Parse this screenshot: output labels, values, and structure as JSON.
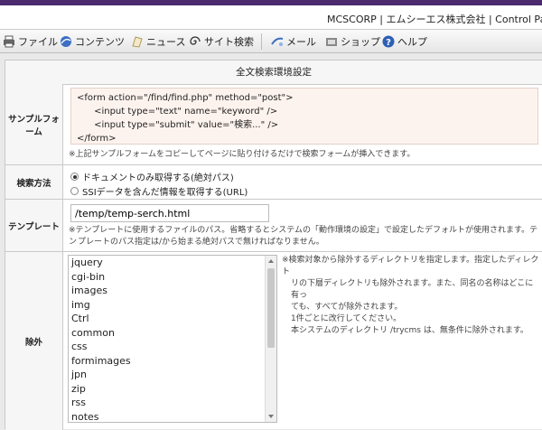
{
  "header": {
    "title": "MCSCORP | エムシーエス株式会社 | Control Pa"
  },
  "toolbar": {
    "items": [
      {
        "label": "ファイル",
        "icon": "printer-icon"
      },
      {
        "label": "コンテンツ",
        "icon": "globe-icon"
      },
      {
        "label": "ニュース",
        "icon": "news-icon"
      },
      {
        "label": "サイト検索",
        "icon": "spiral-icon"
      },
      {
        "label": "メール",
        "icon": "mail-icon"
      },
      {
        "label": "ショップ",
        "icon": "shop-icon"
      },
      {
        "label": "ヘルプ",
        "icon": "help-icon"
      }
    ]
  },
  "panel": {
    "title": "全文検索環境設定"
  },
  "sample_form": {
    "label": "サンプルフォーム",
    "code_lines": [
      "<form action=\"/find/find.php\" method=\"post\">",
      "      <input type=\"text\" name=\"keyword\" />",
      "      <input type=\"submit\" value=\"検索...\" />",
      "</form>"
    ],
    "note": "※上記サンプルフォームをコピーしてページに貼り付けるだけで検索フォームが挿入できます。"
  },
  "search_method": {
    "label": "検索方法",
    "options": [
      {
        "label": "ドキュメントのみ取得する(絶対パス)",
        "selected": true
      },
      {
        "label": "SSIデータを含んだ情報を取得する(URL)",
        "selected": false
      }
    ]
  },
  "template": {
    "label": "テンプレート",
    "value": "/temp/temp-serch.html",
    "note_line1": "※テンプレートに使用するファイルのパス。省略するとシステムの「動作環境の設定」で設定したデフォルトが使用されます。テン",
    "note_line2": "プレートのパス指定は/から始まる絶対パスで無ければなりません。"
  },
  "exclude": {
    "label": "除外",
    "items": [
      "jquery",
      "cgi-bin",
      "images",
      "img",
      "Ctrl",
      "common",
      "css",
      "formimages",
      "jpn",
      "zip",
      "rss",
      "notes"
    ],
    "note_lines": [
      "※検索対象から除外するディレクトリを指定します。指定したディレクト",
      "リの下層ディレクトリも除外されます。また、同名の名称はどこに有っ",
      "ても、すべてが除外されます。",
      "1件ごとに改行してください。",
      "本システムのディレクトリ /trycms は、無条件に除外されます。"
    ]
  }
}
